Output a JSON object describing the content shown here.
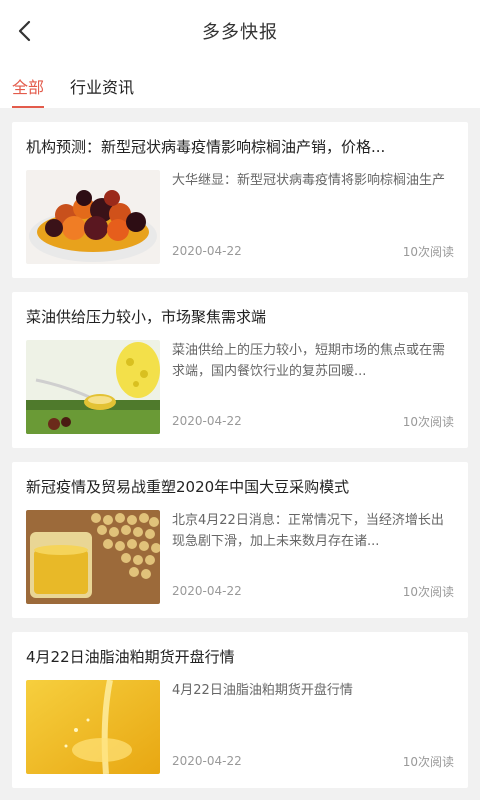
{
  "header": {
    "title": "多多快报",
    "back_icon": "chevron-left-icon"
  },
  "tabs": [
    {
      "label": "全部",
      "active": true
    },
    {
      "label": "行业资讯",
      "active": false
    }
  ],
  "accent_color": "#e35b4b",
  "articles": [
    {
      "title": "机构预测：新型冠状病毒疫情影响棕榈油产销，价格...",
      "summary": "大华继显：新型冠状病毒疫情将影响棕榈油生产",
      "date": "2020-04-22",
      "reads": "10次阅读",
      "image": "palm-fruit-bowl"
    },
    {
      "title": "菜油供给压力较小，市场聚焦需求端",
      "summary": "菜油供给上的压力较小，短期市场的焦点或在需求端，国内餐饮行业的复苏回暖...",
      "date": "2020-04-22",
      "reads": "10次阅读",
      "image": "rapeseed-oil-spoon"
    },
    {
      "title": "新冠疫情及贸易战重塑2020年中国大豆采购模式",
      "summary": "北京4月22日消息：正常情况下，当经济增长出现急剧下滑，加上未来数月存在诸...",
      "date": "2020-04-22",
      "reads": "10次阅读",
      "image": "soybeans-oil-glass"
    },
    {
      "title": "4月22日油脂油粕期货开盘行情",
      "summary": "4月22日油脂油粕期货开盘行情",
      "date": "2020-04-22",
      "reads": "10次阅读",
      "image": "pouring-oil"
    }
  ]
}
